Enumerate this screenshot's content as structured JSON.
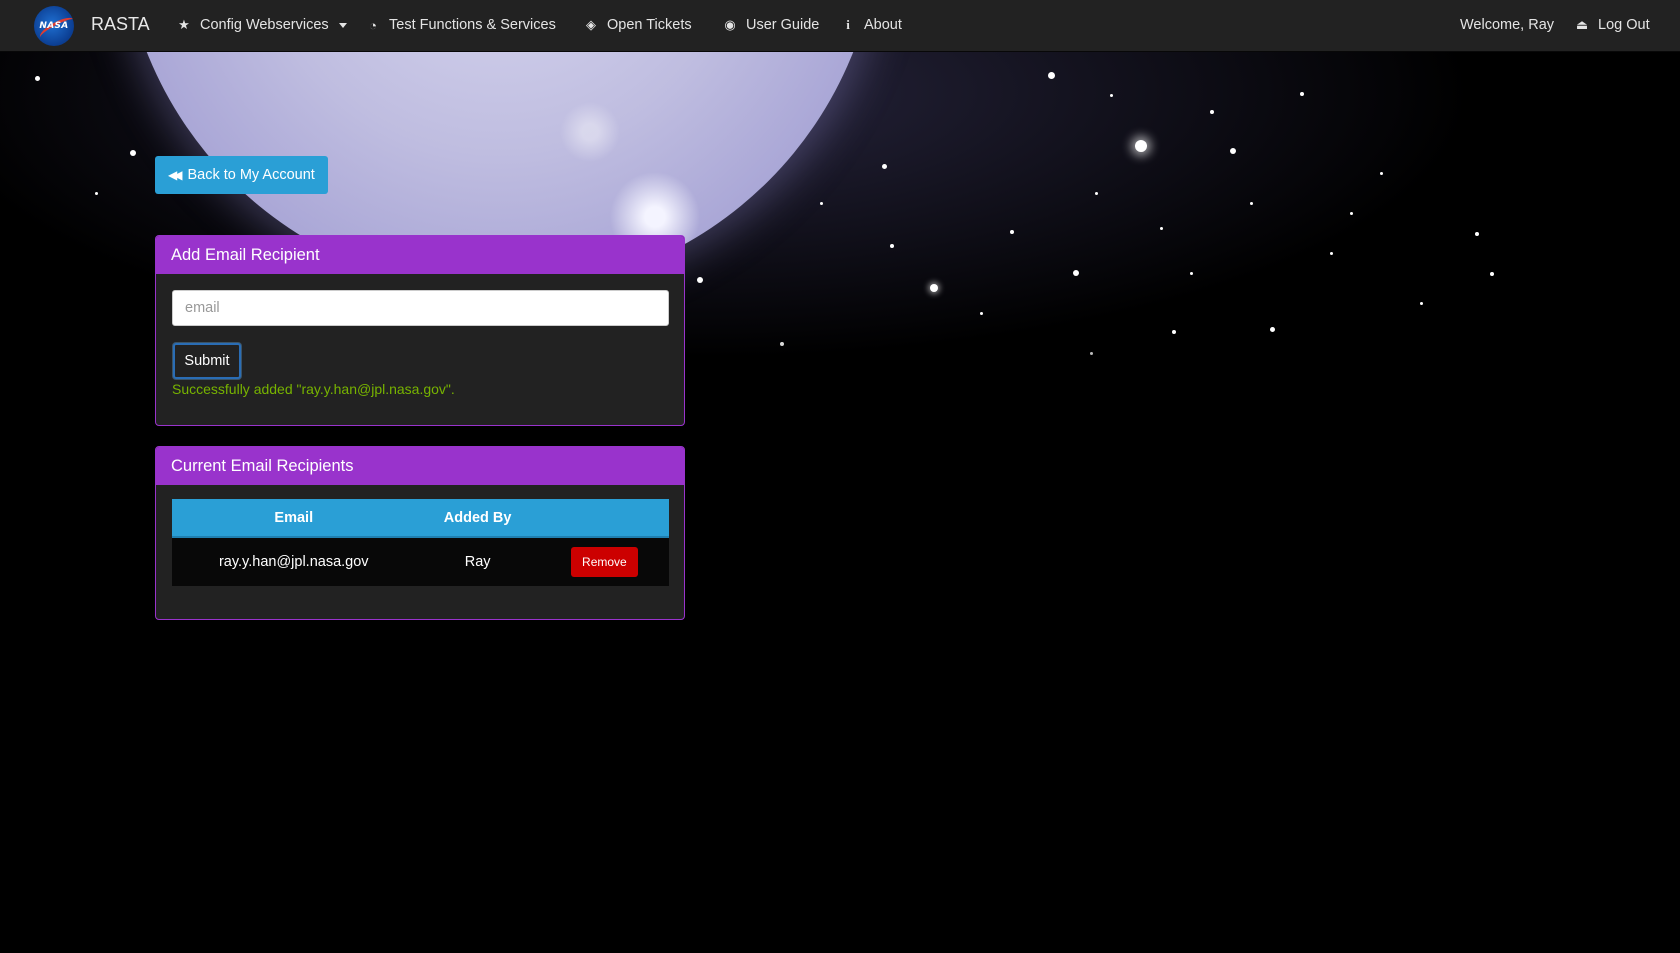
{
  "nav": {
    "logo_text": "NASA",
    "brand": "RASTA",
    "items": [
      {
        "label": "Config Webservices",
        "icon": "star-icon"
      },
      {
        "label": "Test Functions & Services",
        "icon": "dashboard-icon"
      },
      {
        "label": "Open Tickets",
        "icon": "ticket-icon"
      },
      {
        "label": "User Guide",
        "icon": "accessibility-icon"
      },
      {
        "label": "About",
        "icon": "info-icon"
      }
    ],
    "welcome": "Welcome, Ray",
    "logout": "Log Out"
  },
  "back_button": {
    "label": "Back to My Account",
    "icon": "backward-icon"
  },
  "add_panel": {
    "title": "Add Email Recipient",
    "email_placeholder": "email",
    "email_value": "",
    "submit_label": "Submit",
    "success_message": "Successfully added \"ray.y.han@jpl.nasa.gov\"."
  },
  "recipients_panel": {
    "title": "Current Email Recipients",
    "columns": [
      "Email",
      "Added By",
      ""
    ],
    "rows": [
      {
        "email": "ray.y.han@jpl.nasa.gov",
        "added_by": "Ray",
        "action": "Remove"
      }
    ]
  },
  "colors": {
    "navbar": "#222222",
    "panel_accent": "#9933cc",
    "primary": "#2a9fd6",
    "danger": "#cc0000",
    "success_text": "#77b300"
  }
}
